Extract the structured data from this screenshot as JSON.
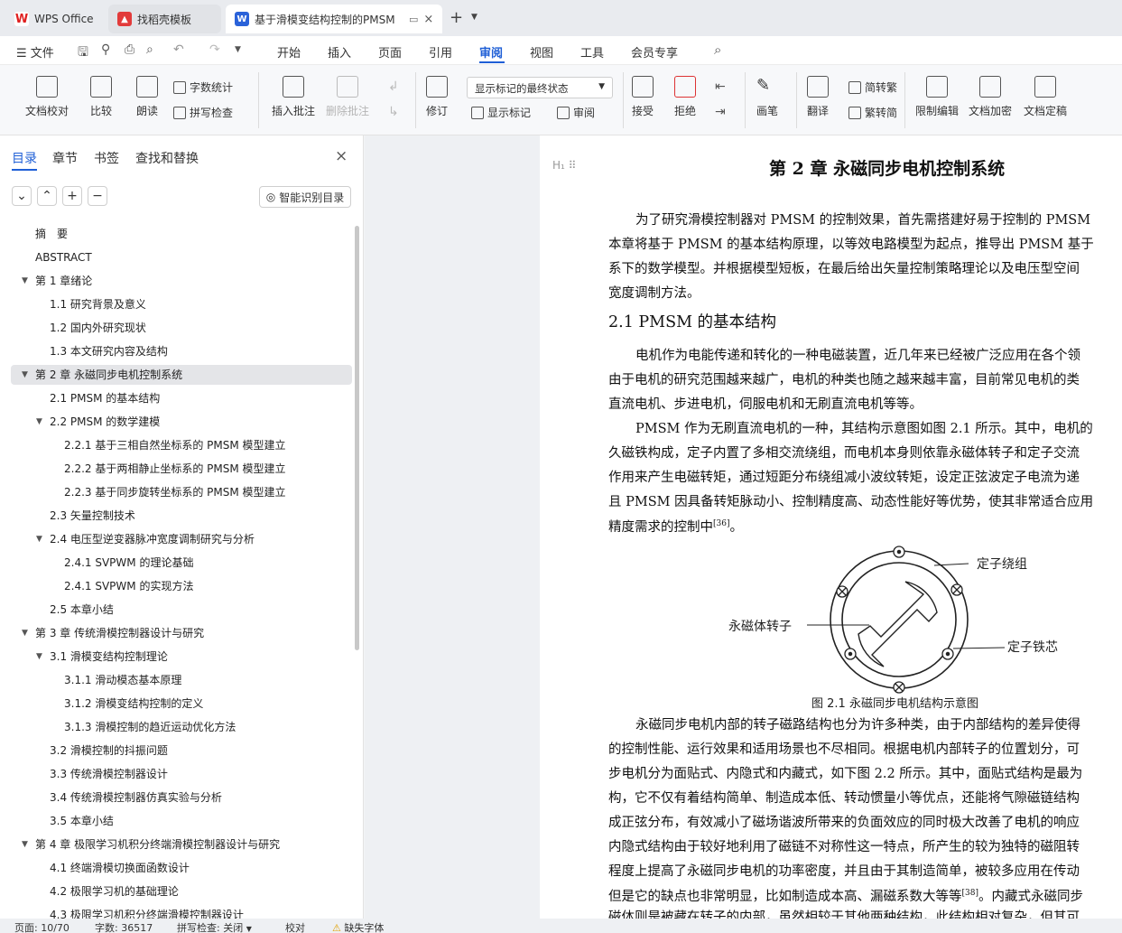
{
  "tabs": [
    {
      "label": "WPS Office"
    },
    {
      "label": "找稻壳模板"
    },
    {
      "label": "基于滑模变结构控制的PMSM"
    }
  ],
  "menu": [
    "文件",
    "开始",
    "插入",
    "页面",
    "引用",
    "审阅",
    "视图",
    "工具",
    "会员专享"
  ],
  "ribbon": {
    "doc_check": "文档校对",
    "compare": "比较",
    "read": "朗读",
    "word_count": "字数统计",
    "spell_check": "拼写检查",
    "insert_comment": "插入批注",
    "delete_comment": "删除批注",
    "revise": "修订",
    "display_select": "显示标记的最终状态",
    "show_marks": "显示标记",
    "review": "审阅",
    "accept": "接受",
    "reject": "拒绝",
    "pen": "画笔",
    "translate": "翻译",
    "to_trad": "简转繁",
    "to_simp": "繁转简",
    "restrict": "限制编辑",
    "encrypt": "文档加密",
    "finalize": "文档定稿"
  },
  "nav": {
    "tabs": [
      "目录",
      "章节",
      "书签",
      "查找和替换"
    ],
    "smart": "智能识别目录",
    "items": [
      "摘　要",
      "ABSTRACT",
      "第 1 章绪论",
      "1.1  研究背景及意义",
      "1.2  国内外研究现状",
      "1.3  本文研究内容及结构",
      "第 2 章  永磁同步电机控制系统",
      "2.1 PMSM 的基本结构",
      "2.2 PMSM 的数学建模",
      "2.2.1  基于三相自然坐标系的 PMSM 模型建立",
      "2.2.2  基于两相静止坐标系的 PMSM 模型建立",
      "2.2.3  基于同步旋转坐标系的 PMSM 模型建立",
      "2.3  矢量控制技术",
      "2.4  电压型逆变器脉冲宽度调制研究与分析",
      "2.4.1 SVPWM 的理论基础",
      "2.4.1 SVPWM 的实现方法",
      "2.5  本章小结",
      "第 3 章  传统滑模控制器设计与研究",
      "3.1  滑模变结构控制理论",
      "3.1.1  滑动模态基本原理",
      "3.1.2  滑模变结构控制的定义",
      "3.1.3  滑模控制的趋近运动优化方法",
      "3.2  滑模控制的抖振问题",
      "3.3  传统滑模控制器设计",
      "3.4  传统滑模控制器仿真实验与分析",
      "3.5  本章小结",
      "第 4 章  极限学习机积分终端滑模控制器设计与研究",
      "4.1  终端滑模切换面函数设计",
      "4.2  极限学习机的基础理论",
      "4.3  极限学习机积分终端滑模控制器设计"
    ]
  },
  "doc": {
    "title": "第 2 章  永磁同步电机控制系统",
    "p1": [
      "为了研究滑模控制器对 PMSM 的控制效果，首先需搭建好易于控制的 PMSM",
      "本章将基于 PMSM 的基本结构原理，以等效电路模型为起点，推导出 PMSM 基于",
      "系下的数学模型。并根据模型短板，在最后给出矢量控制策略理论以及电压型空间",
      "宽度调制方法。"
    ],
    "h21": "2.1 PMSM 的基本结构",
    "p2": [
      "电机作为电能传递和转化的一种电磁装置，近几年来已经被广泛应用在各个领",
      "由于电机的研究范围越来越广，电机的种类也随之越来越丰富，目前常见电机的类",
      "直流电机、步进电机，伺服电机和无刷直流电机等等。"
    ],
    "p3": [
      "PMSM 作为无刷直流电机的一种，其结构示意图如图 2.1 所示。其中，电机的",
      "久磁铁构成，定子内置了多相交流绕组，而电机本身则依靠永磁体转子和定子交流",
      "作用来产生电磁转矩，通过短距分布绕组减小波纹转矩，设定正弦波定子电流为递",
      "且 PMSM 因具备转矩脉动小、控制精度高、动态性能好等优势，使其非常适合应用",
      "精度需求的控制中"
    ],
    "ref36": "[36]",
    "period": "。",
    "fig": {
      "stator_winding": "定子绕组",
      "rotor": "永磁体转子",
      "stator_core": "定子铁芯",
      "caption": "图 2.1 永磁同步电机结构示意图"
    },
    "p4": [
      "永磁同步电机内部的转子磁路结构也分为许多种类，由于内部结构的差异使得",
      "的控制性能、运行效果和适用场景也不尽相同。根据电机内部转子的位置划分，可",
      "步电机分为面贴式、内隐式和内藏式，如下图 2.2 所示。其中，面贴式结构是最为",
      "构，它不仅有着结构简单、制造成本低、转动惯量小等优点，还能将气隙磁链结构",
      "成正弦分布，有效减小了磁场谐波所带来的负面效应的同时极大改善了电机的响应",
      "内隐式结构由于较好地利用了磁链不对称性这一特点，所产生的较为独特的磁阻转",
      "程度上提高了永磁同步电机的功率密度，并且由于其制造简单，被较多应用在传动",
      "但是它的缺点也非常明显，比如制造成本高、漏磁系数大等等"
    ],
    "ref38": "[38]",
    "p4_tail": "。内藏式永磁同步",
    "p4_last": "磁体则是被藏在转子的内部，虽然相较于其他两种结构，此结构相对复杂，但其可"
  },
  "status": {
    "page": "页面: 10/70",
    "words": "字数: 36517",
    "spell": "拼写检查: 关闭",
    "proof": "校对",
    "missing_font": "缺失字体"
  }
}
